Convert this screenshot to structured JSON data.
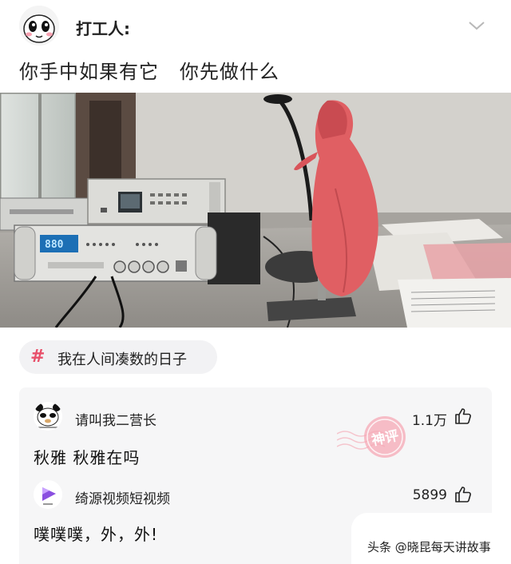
{
  "post": {
    "author": "打工人:",
    "text": "你手中如果有它   你先做什么",
    "image_alt": "桌上功放设备旁的话筒被红布罩住"
  },
  "topic": {
    "hash": "#",
    "label": "我在人间凑数的日子"
  },
  "comments": [
    {
      "user": "请叫我二营长",
      "likes": "1.1万",
      "text": "秋雅 秋雅在吗"
    },
    {
      "user": "绮源视频短视频",
      "likes": "5899",
      "text": "噗噗噗，外，外!"
    }
  ],
  "stamp_label": "神评",
  "watermark": "头条 @晓昆每天讲故事",
  "amp_display": "880",
  "colors": {
    "accent": "#e8506a",
    "stamp": "#f08a9a",
    "bg": "#ffffff",
    "card": "#f6f6f7"
  },
  "icons": [
    "panda-avatar-icon",
    "chevron-down-icon",
    "hash-icon",
    "thumbs-up-icon",
    "play-logo-icon"
  ]
}
